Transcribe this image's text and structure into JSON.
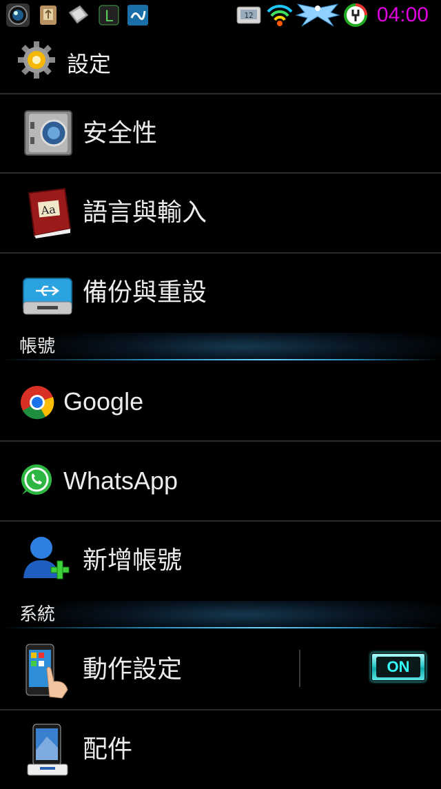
{
  "status_bar": {
    "time": "04:00",
    "icons": [
      "camera-app-icon",
      "usb-icon",
      "sd-card-icon",
      "line-app-icon",
      "notification-icon",
      "clock-widget-icon",
      "wifi-icon",
      "angel-wings-icon",
      "charging-icon"
    ]
  },
  "header": {
    "title": "設定"
  },
  "settings_items_top": [
    {
      "label": "安全性",
      "icon": "safe-icon"
    },
    {
      "label": "語言與輸入",
      "icon": "dictionary-icon"
    },
    {
      "label": "備份與重設",
      "icon": "usb-drive-icon"
    }
  ],
  "sections": {
    "accounts": "帳號",
    "system": "系統"
  },
  "account_items": [
    {
      "label": "Google",
      "icon": "chrome-icon"
    },
    {
      "label": "WhatsApp",
      "icon": "whatsapp-icon"
    },
    {
      "label": "新增帳號",
      "icon": "add-user-icon"
    }
  ],
  "system_items": [
    {
      "label": "動作設定",
      "icon": "motion-phone-icon",
      "toggle": "ON"
    },
    {
      "label": "配件",
      "icon": "phone-dock-icon"
    }
  ],
  "colors": {
    "clock": "#e000e0",
    "accent_glow": "#6fd4ff",
    "toggle": "#33ffff"
  }
}
